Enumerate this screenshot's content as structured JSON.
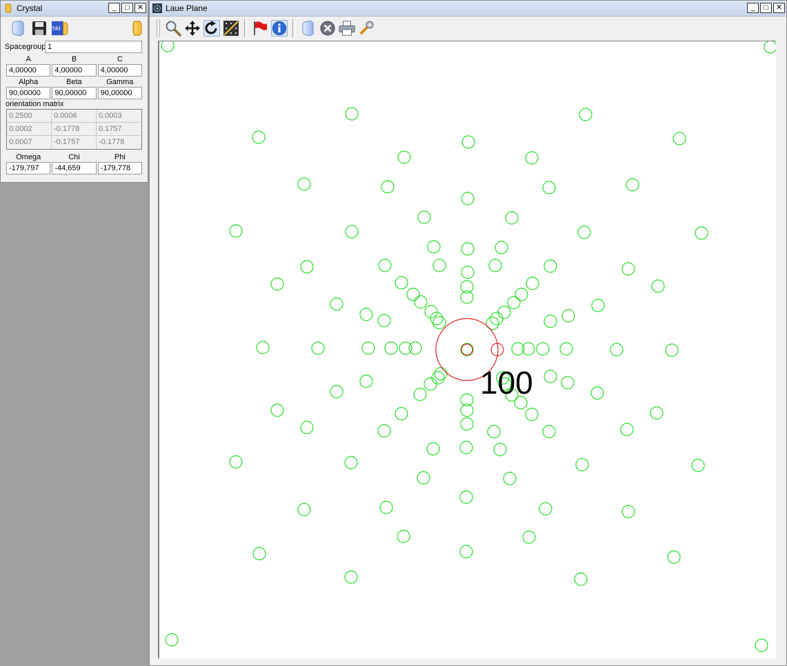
{
  "crystal_window": {
    "title": "Crystal",
    "toolbar": {
      "icons": [
        "crystal-open-icon",
        "save-icon",
        "hkl-icon",
        "crystal-icon"
      ],
      "hkl_label": "hkl"
    },
    "spacegroup": {
      "label": "Spacegroup",
      "value": "1"
    },
    "lattice": {
      "headers": [
        "A",
        "B",
        "C"
      ],
      "values": [
        "4,00000",
        "4,00000",
        "4,00000"
      ]
    },
    "angles": {
      "headers": [
        "Alpha",
        "Beta",
        "Gamma"
      ],
      "values": [
        "90,00000",
        "90,00000",
        "90,00000"
      ]
    },
    "orientation_matrix": {
      "label": "orientation matrix",
      "rows": [
        [
          "0.2500",
          "0.0006",
          "0.0003"
        ],
        [
          "0.0002",
          "-0.1778",
          "0.1757"
        ],
        [
          "0.0007",
          "-0.1757",
          "-0.1778"
        ]
      ]
    },
    "rotation": {
      "headers": [
        "Omega",
        "Chi",
        "Phi"
      ],
      "values": [
        "-179,797",
        "-44,659",
        "-179,778"
      ]
    }
  },
  "laue_window": {
    "title": "Laue Plane",
    "toolbar": {
      "icons": [
        "zoom-icon",
        "pan-icon",
        "rotate-icon",
        "grid-icon",
        "flag-icon",
        "info-icon",
        "crystal-icon",
        "clear-icon",
        "print-icon",
        "settings-icon"
      ]
    },
    "plot": {
      "label": "100",
      "spot_color": "#22dd22",
      "marker_color": "#dd2222"
    }
  },
  "window_buttons": {
    "minimize": "_",
    "maximize": "□",
    "close": "✕"
  }
}
